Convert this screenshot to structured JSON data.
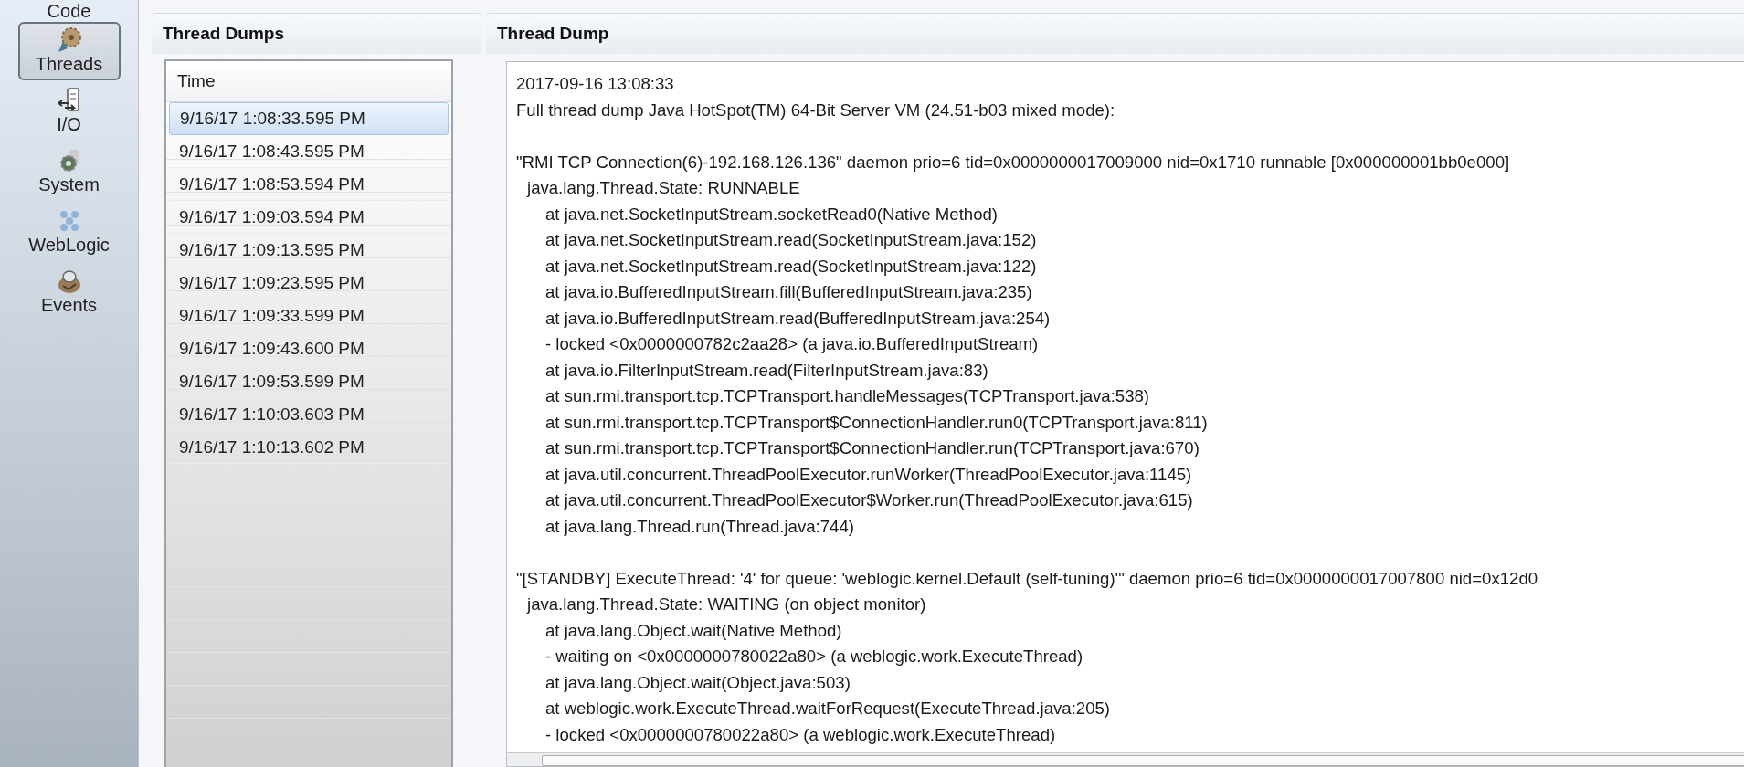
{
  "sidebar": {
    "items": [
      {
        "label": "Code",
        "kind": "code",
        "selected": false
      },
      {
        "label": "Threads",
        "kind": "threads",
        "selected": true
      },
      {
        "label": "I/O",
        "kind": "io",
        "selected": false
      },
      {
        "label": "System",
        "kind": "system",
        "selected": false
      },
      {
        "label": "WebLogic",
        "kind": "weblogic",
        "selected": false
      },
      {
        "label": "Events",
        "kind": "events",
        "selected": false
      }
    ]
  },
  "thread_dumps": {
    "title": "Thread Dumps",
    "columns": [
      "Time"
    ],
    "rows": [
      {
        "time": "9/16/17 1:08:33.595 PM",
        "selected": true
      },
      {
        "time": "9/16/17 1:08:43.595 PM",
        "selected": false
      },
      {
        "time": "9/16/17 1:08:53.594 PM",
        "selected": false
      },
      {
        "time": "9/16/17 1:09:03.594 PM",
        "selected": false
      },
      {
        "time": "9/16/17 1:09:13.595 PM",
        "selected": false
      },
      {
        "time": "9/16/17 1:09:23.595 PM",
        "selected": false
      },
      {
        "time": "9/16/17 1:09:33.599 PM",
        "selected": false
      },
      {
        "time": "9/16/17 1:09:43.600 PM",
        "selected": false
      },
      {
        "time": "9/16/17 1:09:53.599 PM",
        "selected": false
      },
      {
        "time": "9/16/17 1:10:03.603 PM",
        "selected": false
      },
      {
        "time": "9/16/17 1:10:13.602 PM",
        "selected": false
      }
    ]
  },
  "thread_dump": {
    "title": "Thread Dump",
    "timestamp": "2017-09-16 13:08:33",
    "banner": "Full thread dump Java HotSpot(TM) 64-Bit Server VM (24.51-b03 mixed mode):",
    "threads": [
      {
        "header": "\"RMI TCP Connection(6)-192.168.126.136\" daemon prio=6 tid=0x0000000017009000 nid=0x1710 runnable [0x000000001bb0e000]",
        "state": "java.lang.Thread.State: RUNNABLE",
        "frames": [
          "at java.net.SocketInputStream.socketRead0(Native Method)",
          "at java.net.SocketInputStream.read(SocketInputStream.java:152)",
          "at java.net.SocketInputStream.read(SocketInputStream.java:122)",
          "at java.io.BufferedInputStream.fill(BufferedInputStream.java:235)",
          "at java.io.BufferedInputStream.read(BufferedInputStream.java:254)",
          "- locked <0x0000000782c2aa28> (a java.io.BufferedInputStream)",
          "at java.io.FilterInputStream.read(FilterInputStream.java:83)",
          "at sun.rmi.transport.tcp.TCPTransport.handleMessages(TCPTransport.java:538)",
          "at sun.rmi.transport.tcp.TCPTransport$ConnectionHandler.run0(TCPTransport.java:811)",
          "at sun.rmi.transport.tcp.TCPTransport$ConnectionHandler.run(TCPTransport.java:670)",
          "at java.util.concurrent.ThreadPoolExecutor.runWorker(ThreadPoolExecutor.java:1145)",
          "at java.util.concurrent.ThreadPoolExecutor$Worker.run(ThreadPoolExecutor.java:615)",
          "at java.lang.Thread.run(Thread.java:744)"
        ]
      },
      {
        "header": "\"[STANDBY] ExecuteThread: '4' for queue: 'weblogic.kernel.Default (self-tuning)'\" daemon prio=6 tid=0x0000000017007800 nid=0x12d0",
        "state": "java.lang.Thread.State: WAITING (on object monitor)",
        "frames": [
          "at java.lang.Object.wait(Native Method)",
          "- waiting on <0x0000000780022a80> (a weblogic.work.ExecuteThread)",
          "at java.lang.Object.wait(Object.java:503)",
          "at weblogic.work.ExecuteThread.waitForRequest(ExecuteThread.java:205)",
          "- locked <0x0000000780022a80> (a weblogic.work.ExecuteThread)"
        ]
      }
    ]
  }
}
